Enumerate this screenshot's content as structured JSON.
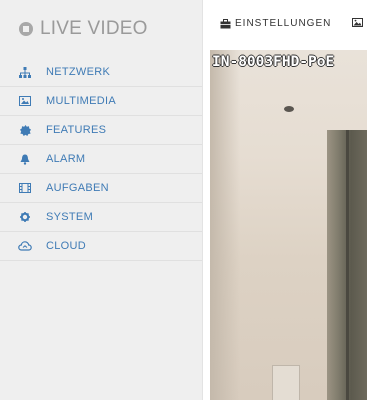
{
  "brand": {
    "title": "LIVE VIDEO",
    "icon": "stop-circle-icon"
  },
  "sidebar": {
    "label_color": "#3f7bb5",
    "items": [
      {
        "label": "NETZWERK",
        "icon": "sitemap-icon"
      },
      {
        "label": "MULTIMEDIA",
        "icon": "image-icon"
      },
      {
        "label": "FEATURES",
        "icon": "gear-badge-icon"
      },
      {
        "label": "ALARM",
        "icon": "bell-icon"
      },
      {
        "label": "AUFGABEN",
        "icon": "film-icon"
      },
      {
        "label": "SYSTEM",
        "icon": "cog-icon"
      },
      {
        "label": "CLOUD",
        "icon": "cloud-icon"
      }
    ]
  },
  "topbar": {
    "tabs": [
      {
        "label": "EINSTELLUNGEN",
        "icon": "briefcase-icon"
      },
      {
        "label": "",
        "icon": "image-icon"
      }
    ]
  },
  "video": {
    "osd_text": "IN-8003FHD-PoE"
  }
}
